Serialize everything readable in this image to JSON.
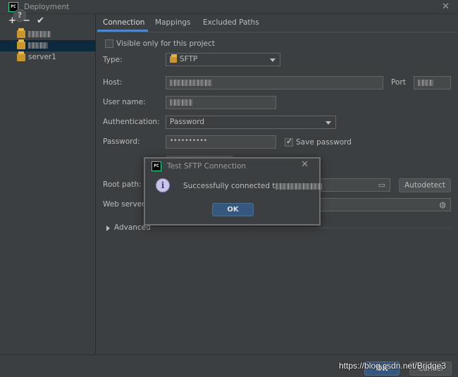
{
  "window": {
    "title": "Deployment",
    "app_icon": "PC"
  },
  "toolbar": {
    "add": "+",
    "remove": "−",
    "apply": "✔"
  },
  "servers": [
    {
      "label": "",
      "redacted": true,
      "selected": false
    },
    {
      "label": "",
      "redacted": true,
      "selected": true
    },
    {
      "label": "server1",
      "redacted": false,
      "selected": false
    }
  ],
  "tabs": {
    "connection": "Connection",
    "mappings": "Mappings",
    "excluded": "Excluded Paths"
  },
  "form": {
    "visible_only_label": "Visible only for this project",
    "visible_only_checked": false,
    "type_label": "Type:",
    "type_value": "SFTP",
    "host_label": "Host:",
    "host_value": "",
    "port_label": "Port",
    "port_value": "",
    "username_label": "User name:",
    "username_value": "",
    "auth_label": "Authentication:",
    "auth_value": "Password",
    "password_label": "Password:",
    "password_value": "••••••••••",
    "save_password_label": "Save password",
    "save_password_checked": true,
    "root_path_label": "Root path:",
    "autodetect_label": "Autodetect",
    "web_server_label": "Web server",
    "advanced_label": "Advanced"
  },
  "dialog": {
    "title": "Test SFTP Connection",
    "app_icon": "PC",
    "message": "Successfully connected t",
    "ok_label": "OK"
  },
  "footer": {
    "help": "?",
    "ok_label": "OK",
    "cancel_label": "Cancel",
    "watermark": "https://blog.csdn.net/Bridge3"
  },
  "colors": {
    "background": "#3c3f41",
    "selection": "#0d293e",
    "accent": "#4a88c7",
    "primary_button": "#365880"
  }
}
